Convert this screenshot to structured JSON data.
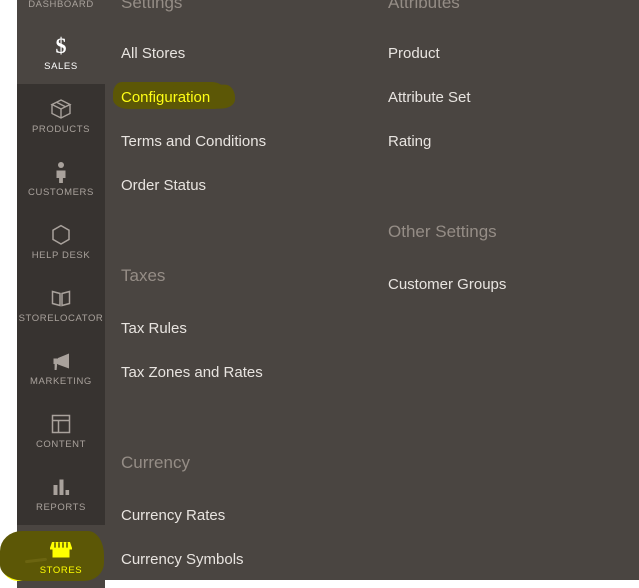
{
  "sidebar": {
    "items": [
      {
        "label": "DASHBOARD",
        "icon": "dashboard-icon",
        "state": "cut-off-top"
      },
      {
        "label": "SALES",
        "icon": "dollar-icon",
        "state": "active"
      },
      {
        "label": "PRODUCTS",
        "icon": "box-icon",
        "state": "normal"
      },
      {
        "label": "CUSTOMERS",
        "icon": "person-icon",
        "state": "normal"
      },
      {
        "label": "HELP DESK",
        "icon": "hexagon-icon",
        "state": "normal"
      },
      {
        "label": "STORELOCATOR",
        "icon": "map-icon",
        "state": "normal"
      },
      {
        "label": "MARKETING",
        "icon": "megaphone-icon",
        "state": "normal"
      },
      {
        "label": "CONTENT",
        "icon": "layout-icon",
        "state": "normal"
      },
      {
        "label": "REPORTS",
        "icon": "bar-chart-icon",
        "state": "normal"
      },
      {
        "label": "STORES",
        "icon": "storefront-icon",
        "state": "highlighted"
      }
    ]
  },
  "menu": {
    "left_column": {
      "groups": [
        {
          "title": "Settings",
          "items": [
            {
              "label": "All Stores",
              "highlighted": false
            },
            {
              "label": "Configuration",
              "highlighted": true
            },
            {
              "label": "Terms and Conditions",
              "highlighted": false
            },
            {
              "label": "Order Status",
              "highlighted": false
            }
          ]
        },
        {
          "title": "Taxes",
          "items": [
            {
              "label": "Tax Rules",
              "highlighted": false
            },
            {
              "label": "Tax Zones and Rates",
              "highlighted": false
            }
          ]
        },
        {
          "title": "Currency",
          "items": [
            {
              "label": "Currency Rates",
              "highlighted": false
            },
            {
              "label": "Currency Symbols",
              "highlighted": false
            }
          ]
        }
      ]
    },
    "right_column": {
      "groups": [
        {
          "title": "Attributes",
          "items": [
            {
              "label": "Product",
              "highlighted": false
            },
            {
              "label": "Attribute Set",
              "highlighted": false
            },
            {
              "label": "Rating",
              "highlighted": false
            }
          ]
        },
        {
          "title": "Other Settings",
          "items": [
            {
              "label": "Customer Groups",
              "highlighted": false
            }
          ]
        }
      ]
    }
  },
  "colors": {
    "panel_bg": "#4a4541",
    "sidebar_bg": "#373330",
    "sidebar_active_bg": "#4a4541",
    "group_title": "#958d86",
    "menu_link": "#e8e4e0",
    "marker_fill": "#5c5706",
    "marker_text": "#ffff15",
    "marker_pen": "#ffff00",
    "page_margin": "#ffffff"
  }
}
